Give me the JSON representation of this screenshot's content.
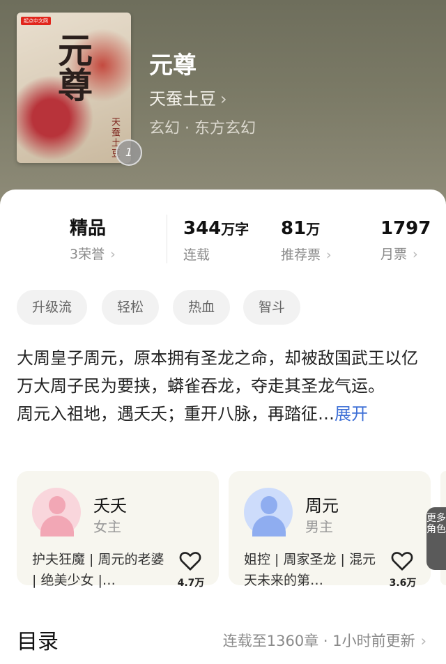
{
  "book": {
    "title": "元尊",
    "author": "天蚕土豆",
    "author_chevron": "›",
    "genre": "玄幻 · 东方玄幻",
    "cover": {
      "badge": "起点中文网",
      "title": "元尊",
      "side_text": "天蚕土豆",
      "rank": "1"
    }
  },
  "stats": [
    {
      "value": "精品",
      "label": "3荣誉",
      "chevron": "›"
    },
    {
      "value": "344",
      "unit": "万字",
      "label": "连载"
    },
    {
      "value": "81",
      "unit": "万",
      "label": "推荐票",
      "chevron": "›"
    },
    {
      "value": "1797",
      "label": "月票",
      "chevron": "›"
    }
  ],
  "tags": [
    "升级流",
    "轻松",
    "热血",
    "智斗"
  ],
  "synopsis": {
    "line1": "大周皇子周元，原本拥有圣龙之命，却被敌国武王以亿万大周子民为要挟，蟒雀吞龙，夺走其圣龙气运。",
    "line2": "周元入祖地，遇夭夭；重开八脉，再踏征…",
    "expand": "展开"
  },
  "characters": [
    {
      "name": "夭夭",
      "role": "女主",
      "desc": "护夫狂魔 | 周元的老婆 | 绝美少女 |…",
      "likes": "4.7万"
    },
    {
      "name": "周元",
      "role": "男主",
      "desc": "姐控 | 周家圣龙 | 混元天未来的第…",
      "likes": "3.6万"
    }
  ],
  "more_roles": "更多角色",
  "toc": {
    "title": "目录",
    "meta": "连载至1360章 · 1小时前更新",
    "chevron": "›"
  },
  "colors": {
    "header_bg": "#7b7a66",
    "accent_link": "#3d6fd6",
    "female_avatar": "#f7c3cc",
    "male_avatar": "#b9cdf6"
  },
  "icons": [
    "heart-icon",
    "chevron-right-icon",
    "rank-badge-icon"
  ]
}
